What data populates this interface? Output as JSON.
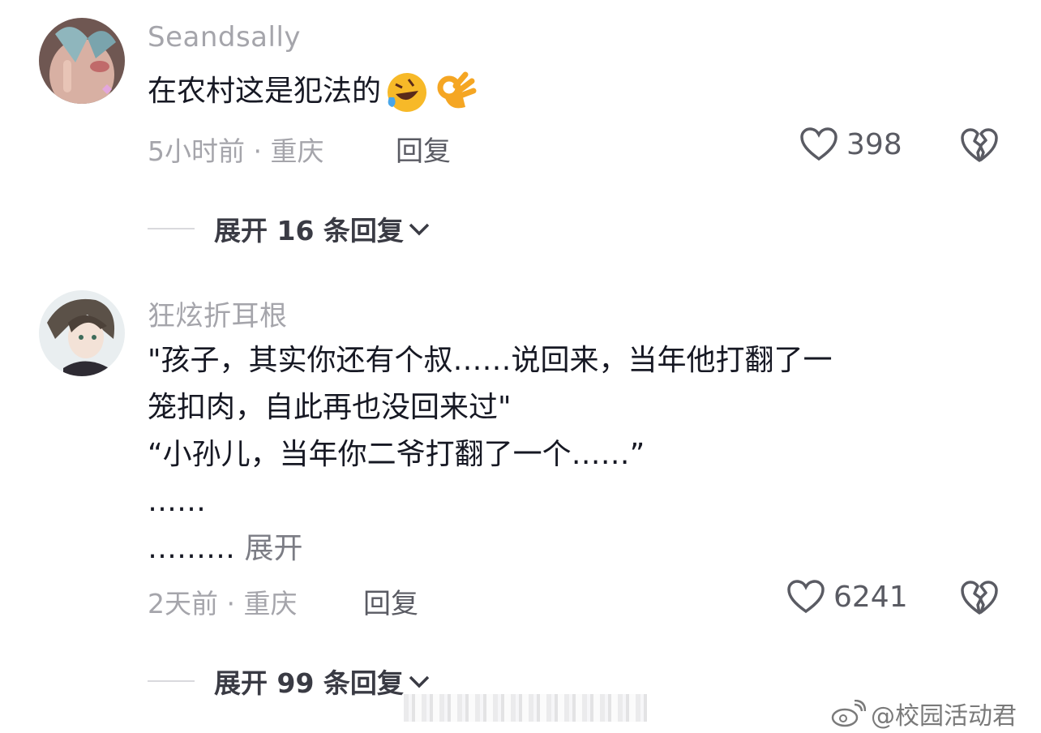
{
  "comments": [
    {
      "username": "Seandsally",
      "text": "在农村这是犯法的",
      "emojis": [
        "rolling-on-floor-laughing",
        "ok-hand"
      ],
      "time": "5小时前 · 重庆",
      "reply_label": "回复",
      "likes": "398",
      "expand_label": "展开 16 条回复"
    },
    {
      "username": "狂炫折耳根",
      "lines": [
        "\"孩子，其实你还有个叔……说回来，当年他打翻了一",
        "笼扣肉，自此再也没回来过\"",
        "“小孙儿，当年你二爷打翻了一个……”",
        "……",
        "………"
      ],
      "more_label": "展开",
      "time": "2天前 · 重庆",
      "reply_label": "回复",
      "likes": "6241",
      "expand_label": "展开 99 条回复"
    }
  ],
  "watermark": "@校园活动君",
  "colors": {
    "muted": "#a5a5ab",
    "text": "#161823",
    "icon": "#5a5b63"
  }
}
